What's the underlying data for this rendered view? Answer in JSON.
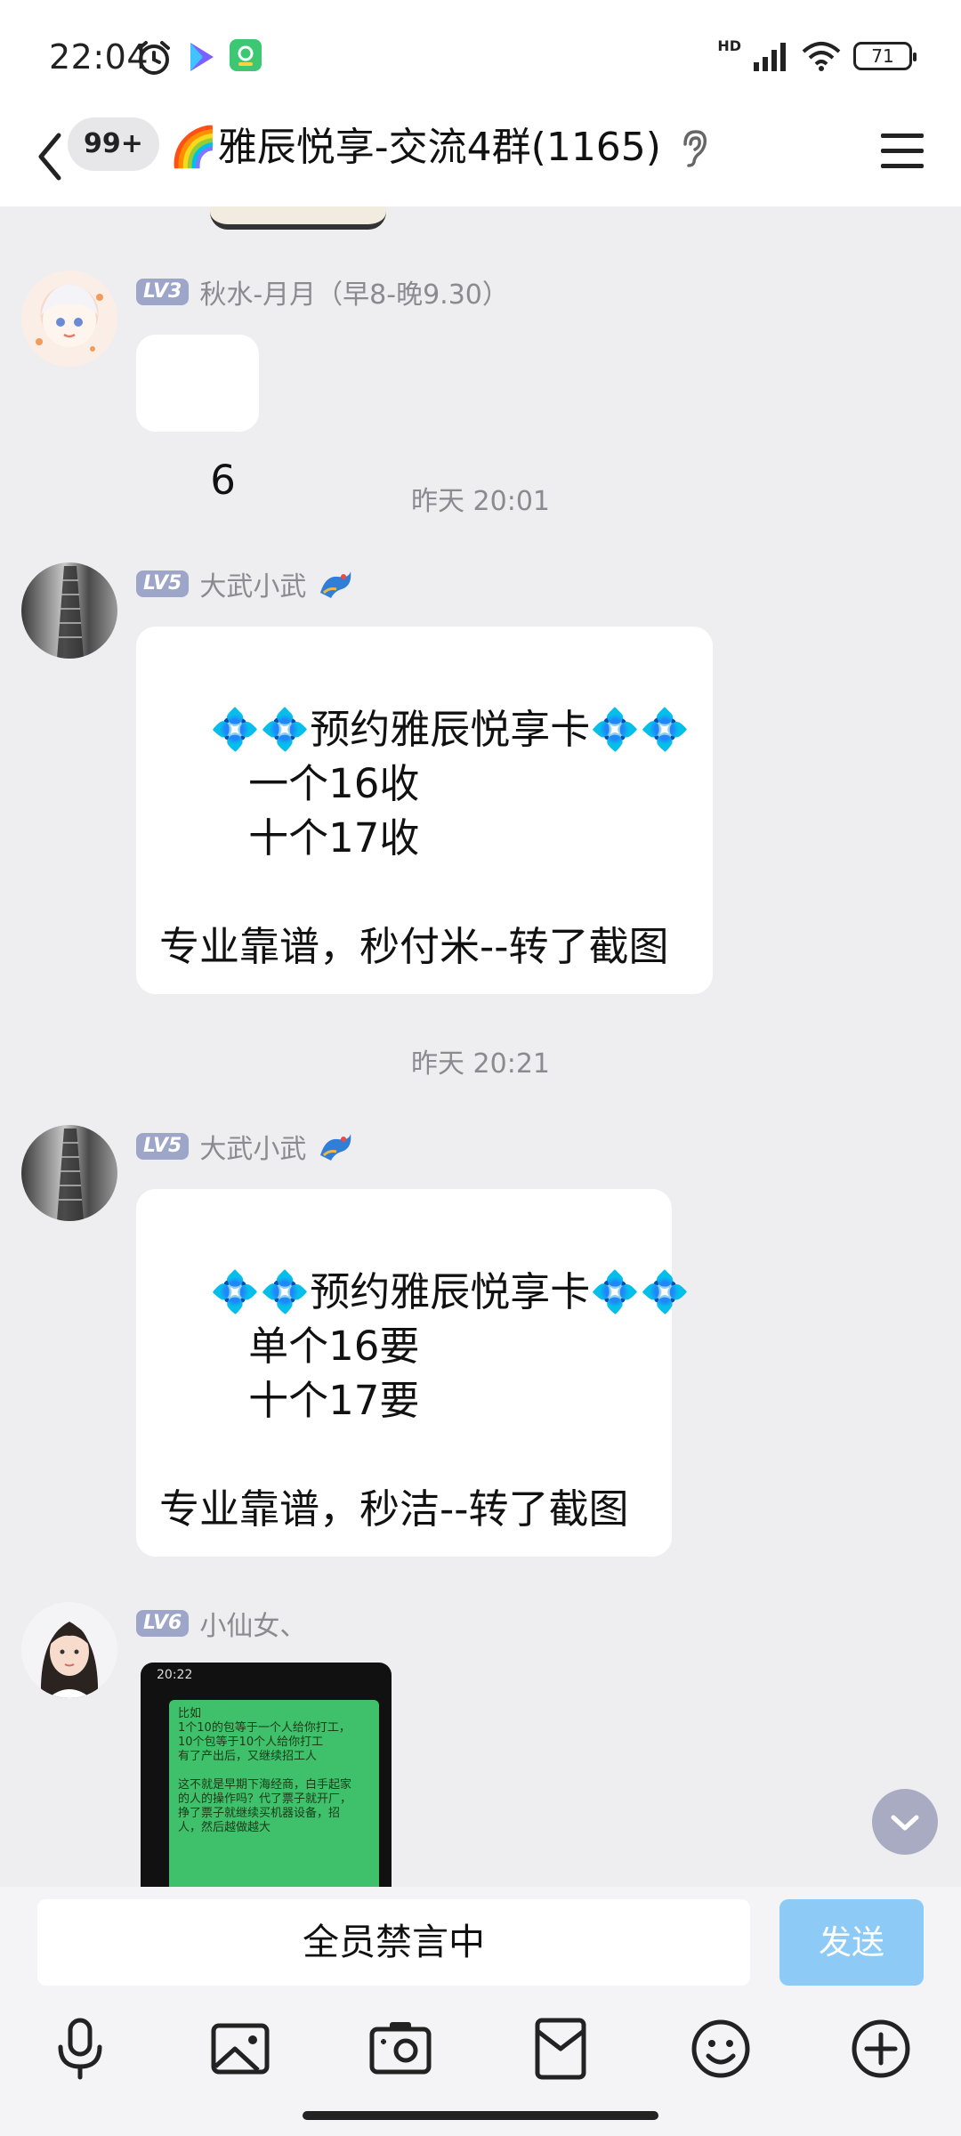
{
  "status_bar": {
    "time": "22:04",
    "battery": "71",
    "network_label": "HD",
    "icons": [
      "alarm-icon",
      "video-app-icon",
      "app-icon",
      "signal-icon",
      "wifi-icon",
      "battery-icon"
    ]
  },
  "header": {
    "back_icon": "chevron-left-icon",
    "unread_count": "99+",
    "title": "🌈雅辰悦享-交流4群(1165)",
    "ear_icon": "ear-icon",
    "menu_icon": "menu-icon"
  },
  "messages": [
    {
      "type": "message",
      "level": "LV3",
      "sender": "秋水-月月（早8-晚9.30）",
      "text": "6"
    },
    {
      "type": "timestamp",
      "text": "昨天 20:01"
    },
    {
      "type": "message",
      "level": "LV5",
      "sender": "大武小武",
      "badge_icon": "dragon-badge-icon",
      "text": "💠💠预约雅辰悦享卡💠💠\n       一个16收\n       十个17收\n\n专业靠谱，秒付米--转了截图"
    },
    {
      "type": "timestamp",
      "text": "昨天 20:21"
    },
    {
      "type": "message",
      "level": "LV5",
      "sender": "大武小武",
      "badge_icon": "dragon-badge-icon",
      "text": "💠💠预约雅辰悦享卡💠💠\n       单个16要\n       十个17要\n\n专业靠谱，秒洁--转了截图"
    },
    {
      "type": "message",
      "level": "LV6",
      "sender": "小仙女、",
      "image_icon": "chat-screenshot-image",
      "image_text": {
        "status_time": "20:22",
        "lines": [
          "比如",
          "1个10的包等于一个人给你打工，",
          "10个包等于10个人给你打工",
          "有了产出后，又继续招工人",
          "",
          "这不就是早期下海经商，白手起家",
          "的人的操作吗？代了票子就开厂，",
          "挣了票子就继续买机器设备，招",
          "人，然后越做越大"
        ]
      }
    }
  ],
  "scroll_down_icon": "chevron-down-icon",
  "input_bar": {
    "muted_text": "全员禁言中",
    "send_label": "发送"
  },
  "toolbar": {
    "icons": [
      "microphone-icon",
      "image-icon",
      "camera-icon",
      "red-packet-icon",
      "emoji-icon",
      "plus-circle-icon"
    ]
  },
  "colors": {
    "chat_background": "#eeeef1",
    "level_badge": "#9da5c9",
    "send_button": "#8dcaf6"
  }
}
